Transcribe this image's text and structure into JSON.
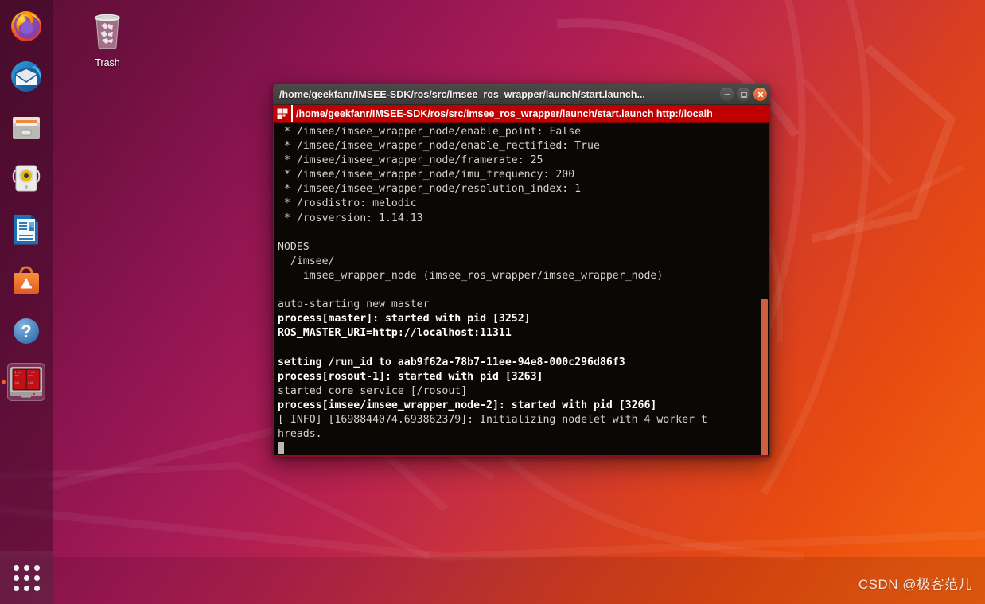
{
  "desktop": {
    "wallpaper_colors": {
      "magenta": "#5b0f33",
      "mid_magenta": "#a51a56",
      "orange": "#f2600e"
    },
    "watermark": "CSDN @极客范儿",
    "icons": [
      {
        "name": "trash",
        "label": "Trash"
      }
    ]
  },
  "launcher": {
    "items": [
      {
        "icon": "firefox-icon",
        "label": "Firefox Web Browser",
        "active": false,
        "running": false
      },
      {
        "icon": "thunderbird-icon",
        "label": "Thunderbird Mail",
        "active": false,
        "running": false
      },
      {
        "icon": "files-icon",
        "label": "Files",
        "active": false,
        "running": false
      },
      {
        "icon": "rhythmbox-icon",
        "label": "Rhythmbox",
        "active": false,
        "running": false
      },
      {
        "icon": "libreoffice-writer-icon",
        "label": "LibreOffice Writer",
        "active": false,
        "running": false
      },
      {
        "icon": "ubuntu-software-icon",
        "label": "Ubuntu Software",
        "active": false,
        "running": false
      },
      {
        "icon": "help-icon",
        "label": "Help",
        "active": false,
        "running": false
      },
      {
        "icon": "terminal-icon",
        "label": "Terminal",
        "active": true,
        "running": true
      }
    ],
    "app_grid": {
      "icon": "app-grid-icon",
      "label": "Show Applications"
    }
  },
  "window": {
    "title": "/home/geekfanr/IMSEE-SDK/ros/src/imsee_ros_wrapper/launch/start.launch...",
    "buttons": {
      "minimize": "minimize-button",
      "maximize": "maximize-button",
      "close": "close-button"
    },
    "tab": {
      "icon": "terminal-tab-icon",
      "title": "/home/geekfanr/IMSEE-SDK/ros/src/imsee_ros_wrapper/launch/start.launch http://localh"
    },
    "scrollbar": {
      "thumb_color": "#cd6040"
    },
    "terminal": {
      "lines": [
        {
          "text": " * /imsee/imsee_wrapper_node/enable_point: False",
          "bold": false
        },
        {
          "text": " * /imsee/imsee_wrapper_node/enable_rectified: True",
          "bold": false
        },
        {
          "text": " * /imsee/imsee_wrapper_node/framerate: 25",
          "bold": false
        },
        {
          "text": " * /imsee/imsee_wrapper_node/imu_frequency: 200",
          "bold": false
        },
        {
          "text": " * /imsee/imsee_wrapper_node/resolution_index: 1",
          "bold": false
        },
        {
          "text": " * /rosdistro: melodic",
          "bold": false
        },
        {
          "text": " * /rosversion: 1.14.13",
          "bold": false
        },
        {
          "text": "",
          "bold": false
        },
        {
          "text": "NODES",
          "bold": false
        },
        {
          "text": "  /imsee/",
          "bold": false
        },
        {
          "text": "    imsee_wrapper_node (imsee_ros_wrapper/imsee_wrapper_node)",
          "bold": false
        },
        {
          "text": "",
          "bold": false
        },
        {
          "text": "auto-starting new master",
          "bold": false
        },
        {
          "text": "process[master]: started with pid [3252]",
          "bold": true
        },
        {
          "text": "ROS_MASTER_URI=http://localhost:11311",
          "bold": true
        },
        {
          "text": "",
          "bold": false
        },
        {
          "text": "setting /run_id to aab9f62a-78b7-11ee-94e8-000c296d86f3",
          "bold": true
        },
        {
          "text": "process[rosout-1]: started with pid [3263]",
          "bold": true
        },
        {
          "text": "started core service [/rosout]",
          "bold": false
        },
        {
          "text": "process[imsee/imsee_wrapper_node-2]: started with pid [3266]",
          "bold": true
        },
        {
          "text": "[ INFO] [1698844074.693862379]: Initializing nodelet with 4 worker t",
          "bold": false
        },
        {
          "text": "hreads.",
          "bold": false
        }
      ]
    }
  }
}
